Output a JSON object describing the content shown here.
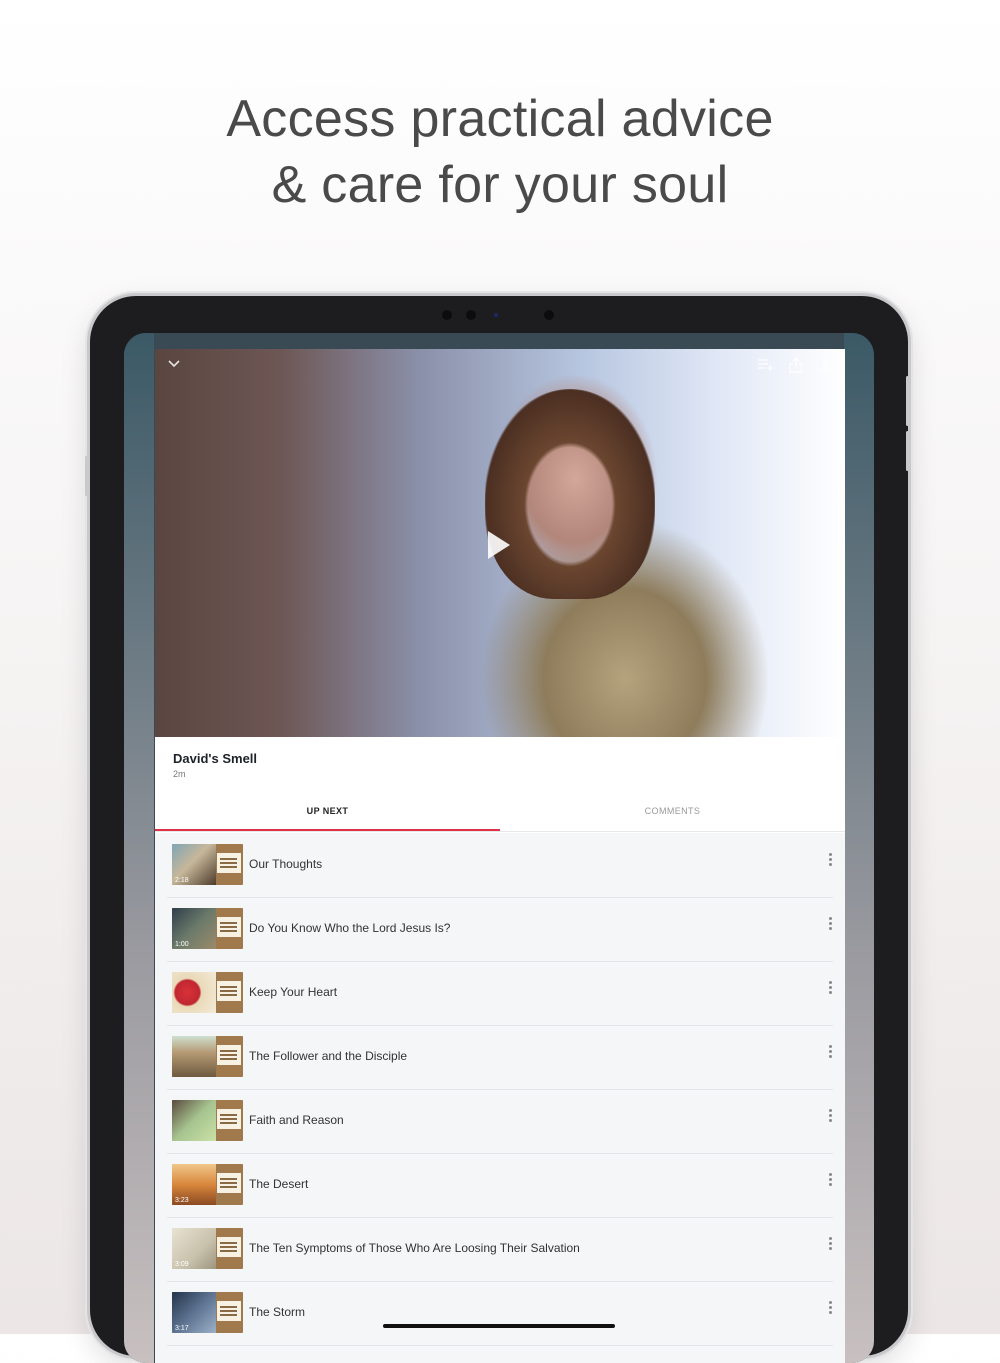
{
  "headline": {
    "line1": "Access practical advice",
    "line2": "& care for your soul"
  },
  "player": {
    "controls": {
      "collapse_icon": "chevron-down-icon",
      "queue_icon": "add-to-queue-icon",
      "share_icon": "share-icon",
      "download_icon": "download-icon",
      "play_icon": "play-icon"
    }
  },
  "video": {
    "title": "David's Smell",
    "duration": "2m"
  },
  "tabs": {
    "up_next": "UP NEXT",
    "comments": "COMMENTS",
    "active": "UP NEXT"
  },
  "accent_color": "#e0314b",
  "playlist": [
    {
      "title": "Our Thoughts",
      "duration": "2:18"
    },
    {
      "title": "Do You Know Who the Lord Jesus Is?",
      "duration": "1:00"
    },
    {
      "title": "Keep Your Heart",
      "duration": ""
    },
    {
      "title": "The Follower and the Disciple",
      "duration": ""
    },
    {
      "title": "Faith and Reason",
      "duration": ""
    },
    {
      "title": "The Desert",
      "duration": "3:23"
    },
    {
      "title": "The Ten Symptoms of Those Who Are Loosing Their Salvation",
      "duration": "3:09"
    },
    {
      "title": "The Storm",
      "duration": "3:17"
    }
  ]
}
